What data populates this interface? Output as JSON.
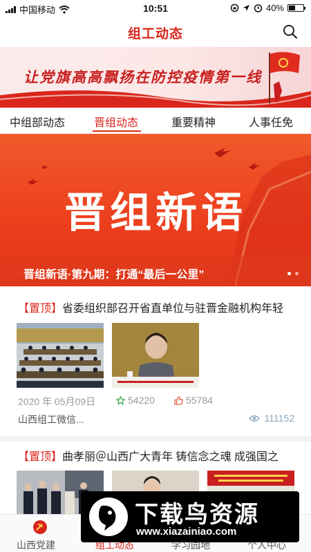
{
  "status_bar": {
    "carrier": "中国移动",
    "time": "10:51",
    "battery": "40%"
  },
  "nav": {
    "title": "组工动态",
    "search_icon": "search-icon"
  },
  "banner": {
    "slogan": "让党旗高高飘扬在防控疫情第一线"
  },
  "tabs": [
    {
      "label": "中组部动态",
      "active": false
    },
    {
      "label": "晋组动态",
      "active": true
    },
    {
      "label": "重要精神",
      "active": false
    },
    {
      "label": "人事任免",
      "active": false
    }
  ],
  "hero": {
    "title": "晋组新语",
    "caption": "晋组新语·第九期：打通“最后一公里”"
  },
  "articles": [
    {
      "pin": "【置顶】",
      "title": "省委组织部召开省直单位与驻晋金融机构年轻",
      "date": "2020 年 05月09日",
      "likes": "54220",
      "thumbs": "55784",
      "source": "山西组工微信...",
      "views": "111152"
    },
    {
      "pin": "【置顶】",
      "title": "曲孝丽＠山西广大青年 铸信念之魂 成强国之"
    }
  ],
  "bottom_tabs": [
    {
      "label": "山西党建",
      "active": false
    },
    {
      "label": "组工动态",
      "active": true
    },
    {
      "label": "学习园地",
      "active": false
    },
    {
      "label": "个人中心",
      "active": false
    }
  ],
  "watermark": {
    "title": "下载鸟资源",
    "url": "www.xiazainiao.com"
  },
  "colors": {
    "accent": "#d9261c",
    "hero": "#ec3e1d",
    "star": "#3aa84c",
    "thumb_up": "#e0503a",
    "views": "#8aa6c1"
  }
}
